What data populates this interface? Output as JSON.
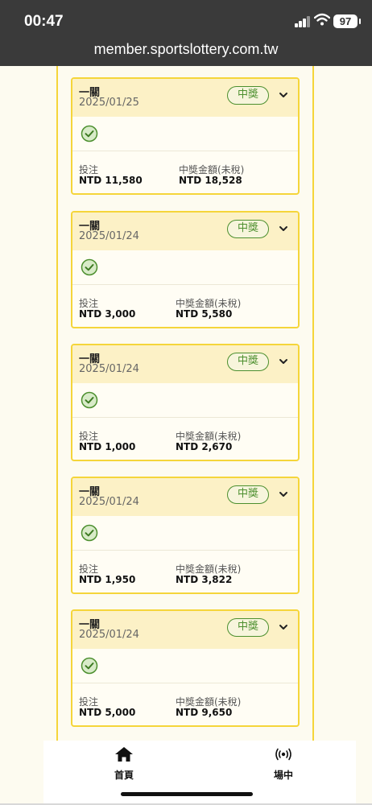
{
  "status_bar": {
    "time": "00:47",
    "battery": "97"
  },
  "browser": {
    "url": "member.sportslottery.com.tw"
  },
  "labels": {
    "stake": "投注",
    "winnings": "中獎金額(未稅)"
  },
  "tickets": [
    {
      "type": "一關",
      "date": "2025/01/25",
      "status": "中獎",
      "stake": "NTD 11,580",
      "winnings": "NTD 18,528"
    },
    {
      "type": "一關",
      "date": "2025/01/24",
      "status": "中獎",
      "stake": "NTD 3,000",
      "winnings": "NTD 5,580"
    },
    {
      "type": "一關",
      "date": "2025/01/24",
      "status": "中獎",
      "stake": "NTD 1,000",
      "winnings": "NTD 2,670"
    },
    {
      "type": "一關",
      "date": "2025/01/24",
      "status": "中獎",
      "stake": "NTD 1,950",
      "winnings": "NTD 3,822"
    },
    {
      "type": "一關",
      "date": "2025/01/24",
      "status": "中獎",
      "stake": "NTD 5,000",
      "winnings": "NTD 9,650"
    }
  ],
  "tab_bar": {
    "home_label": "首頁",
    "live_label": "場中"
  },
  "colors": {
    "accent_yellow": "#f5d53a",
    "win_green": "#4c8f2e",
    "header_bg": "#fcf1c6"
  }
}
